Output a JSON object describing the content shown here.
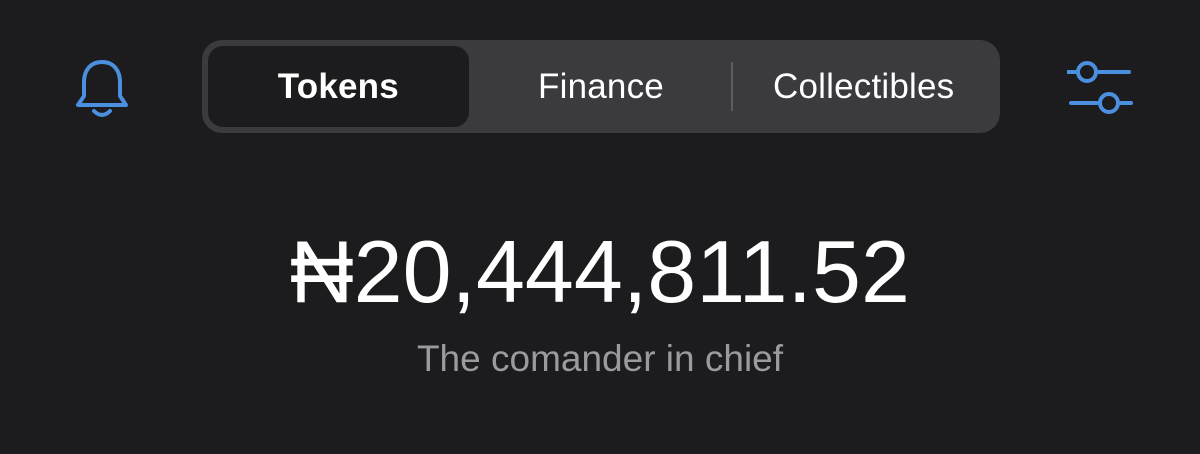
{
  "header": {
    "bell_icon": "bell-icon",
    "filter_icon": "sliders-icon",
    "accent_color": "#4a8fe0"
  },
  "tabs": [
    {
      "label": "Tokens",
      "active": true
    },
    {
      "label": "Finance",
      "active": false
    },
    {
      "label": "Collectibles",
      "active": false
    }
  ],
  "balance": {
    "amount": "₦20,444,811.52",
    "subtitle": "The comander in chief"
  }
}
